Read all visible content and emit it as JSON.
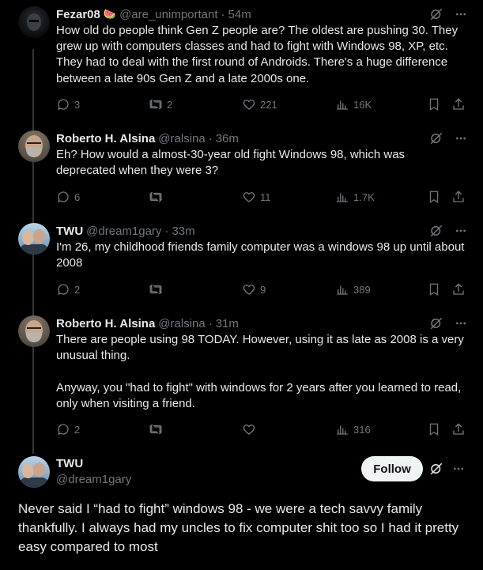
{
  "tweets": [
    {
      "name": "Fezar08",
      "emoji": "🍉",
      "handle": "@are_unimportant",
      "time": "54m",
      "text": "How old do people think Gen Z people are? The oldest are pushing 30. They grew up with computers classes and had to fight with Windows 98, XP, etc. They had to deal with the first round of Androids. There's a huge difference between a late 90s Gen Z and a late 2000s one.",
      "replies": "3",
      "reposts": "2",
      "likes": "221",
      "views": "16K"
    },
    {
      "name": "Roberto H. Alsina",
      "handle": "@ralsina",
      "time": "36m",
      "text": "Eh? How would a almost-30-year old fight Windows 98, which was deprecated when they were 3?",
      "replies": "6",
      "reposts": "",
      "likes": "11",
      "views": "1.7K"
    },
    {
      "name": "TWU",
      "handle": "@dream1gary",
      "time": "33m",
      "text": "I'm 26, my childhood friends family computer was a windows 98 up until about 2008",
      "replies": "2",
      "reposts": "",
      "likes": "9",
      "views": "389"
    },
    {
      "name": "Roberto H. Alsina",
      "handle": "@ralsina",
      "time": "31m",
      "text": "There are people using 98 TODAY. However, using it as late as 2008 is a very unusual thing.\n\nAnyway, you \"had to fight\" with windows for 2 years after you learned to read, only when visiting a friend.",
      "replies": "2",
      "reposts": "",
      "likes": "",
      "views": "316"
    }
  ],
  "main_tweet": {
    "name": "TWU",
    "handle": "@dream1gary",
    "follow_label": "Follow",
    "text": "Never said I “had to fight” windows 98 - we were a tech savvy family thankfully. I always had my uncles to fix computer shit too so I had it pretty easy compared to most"
  },
  "colors": {
    "background": "#000000",
    "text": "#e7e9ea",
    "muted": "#71767b",
    "thread_line": "#333639"
  }
}
